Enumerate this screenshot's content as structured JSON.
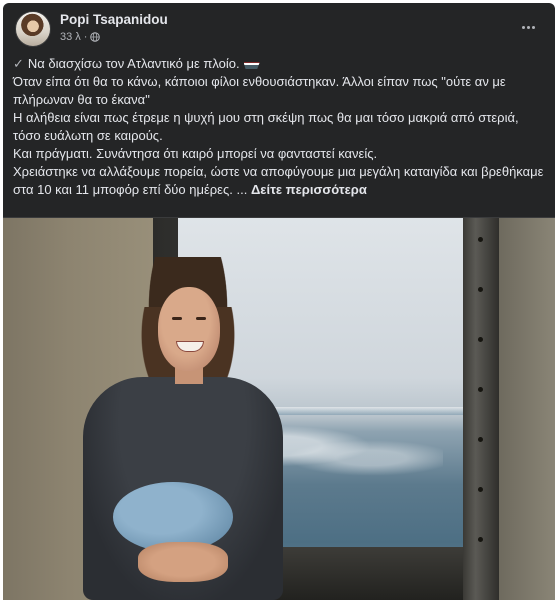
{
  "post": {
    "author": "Popi Tsapanidou",
    "time": "33 λ",
    "separator": "·",
    "privacy_icon": "globe-icon",
    "menu_icon": "more-options-icon"
  },
  "text": {
    "line1": "Να διασχίσω τον Ατλαντικό με πλοίο.",
    "line2": "Όταν είπα ότι θα το κάνω, κάποιοι φίλοι ενθουσιάστηκαν. Άλλοι είπαν πως \"ούτε αν με πλήρωναν θα το έκανα\"",
    "line3": "Η αλήθεια είναι πως έτρεμε η ψυχή μου στη σκέψη πως θα μαι τόσο μακριά από στεριά, τόσο ευάλωτη σε καιρούς.",
    "line4": "Και πράγματι. Συνάντησα ότι καιρό μπορεί να φανταστεί κανείς.",
    "line5": "Χρειάστηκε να αλλάξουμε πορεία, ώστε να αποφύγουμε μια μεγάλη καταιγίδα και βρεθήκαμε στα 10 και 11 μποφόρ επί δύο ημέρες.",
    "ellipsis": "...",
    "see_more": "Δείτε περισσότερα"
  },
  "colors": {
    "card_bg": "#242526",
    "primary_text": "#e4e6eb",
    "secondary_text": "#b0b3b8"
  }
}
